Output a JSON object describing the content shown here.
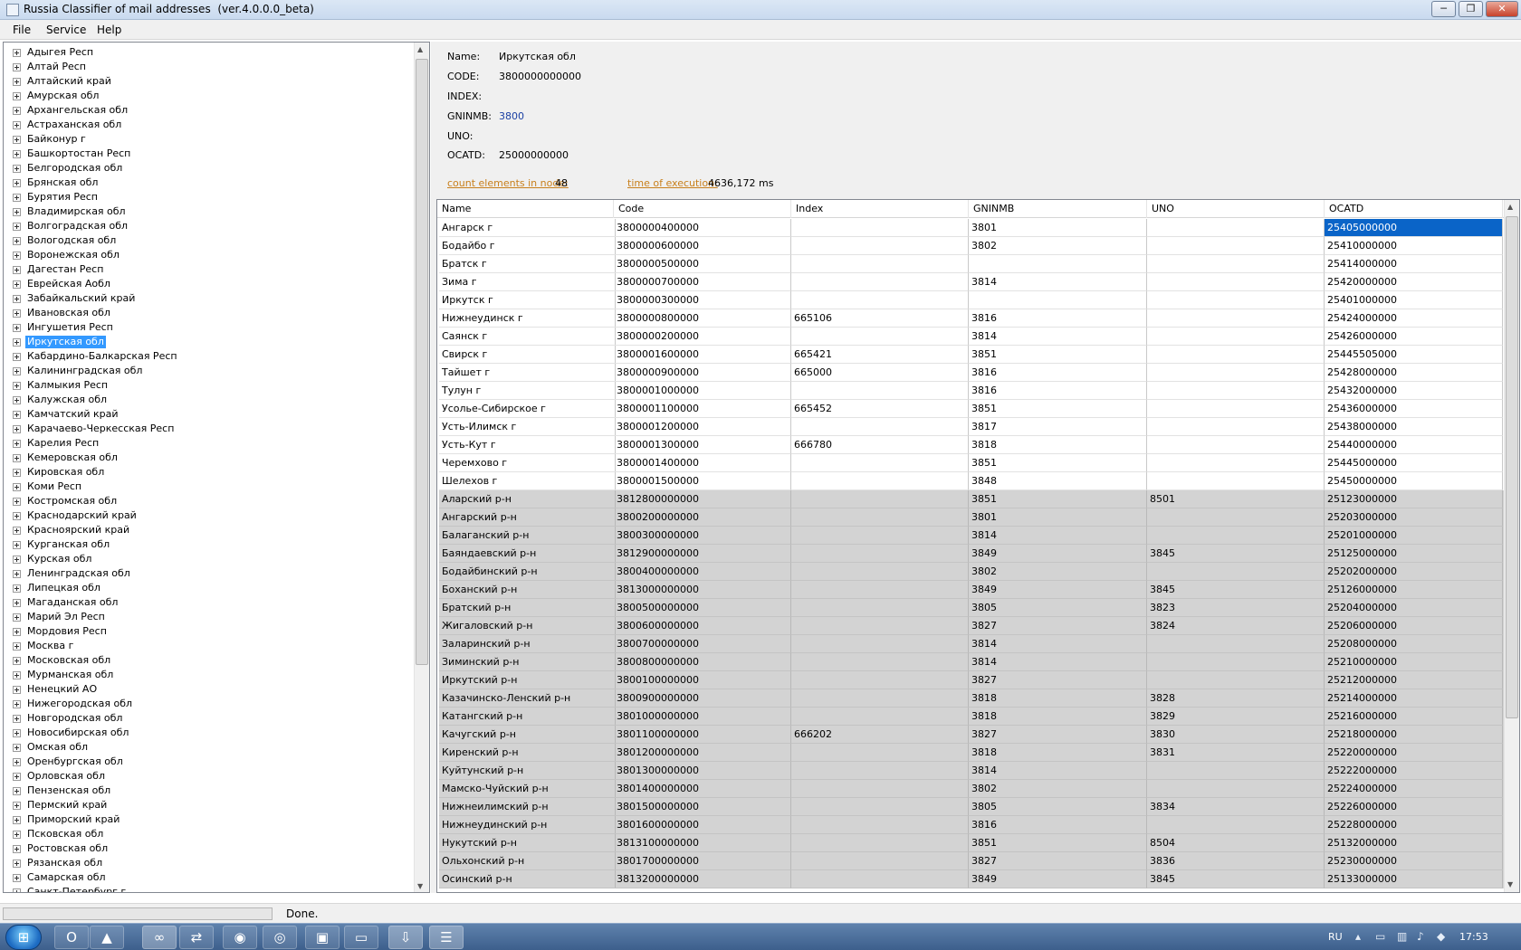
{
  "window": {
    "title": "Russia Classifier of mail addresses  (ver.4.0.0.0_beta)",
    "minimize_glyph": "─",
    "maximize_glyph": "❐",
    "close_glyph": "✕"
  },
  "menu": {
    "items": [
      "File",
      "Service",
      "Help"
    ]
  },
  "tree": {
    "selected_index": 20,
    "items": [
      "Адыгея Респ",
      "Алтай Респ",
      "Алтайский край",
      "Амурская обл",
      "Архангельская обл",
      "Астраханская обл",
      "Байконур г",
      "Башкортостан Респ",
      "Белгородская обл",
      "Брянская обл",
      "Бурятия Респ",
      "Владимирская обл",
      "Волгоградская обл",
      "Вологодская обл",
      "Воронежская обл",
      "Дагестан Респ",
      "Еврейская Аобл",
      "Забайкальский край",
      "Ивановская обл",
      "Ингушетия Респ",
      "Иркутская обл",
      "Кабардино-Балкарская Респ",
      "Калининградская обл",
      "Калмыкия Респ",
      "Калужская обл",
      "Камчатский край",
      "Карачаево-Черкесская Респ",
      "Карелия Респ",
      "Кемеровская обл",
      "Кировская обл",
      "Коми Респ",
      "Костромская обл",
      "Краснодарский край",
      "Красноярский край",
      "Курганская обл",
      "Курская обл",
      "Ленинградская обл",
      "Липецкая обл",
      "Магаданская обл",
      "Марий Эл Респ",
      "Мордовия Респ",
      "Москва г",
      "Московская обл",
      "Мурманская обл",
      "Ненецкий АО",
      "Нижегородская обл",
      "Новгородская обл",
      "Новосибирская обл",
      "Омская обл",
      "Оренбургская обл",
      "Орловская обл",
      "Пензенская обл",
      "Пермский край",
      "Приморский край",
      "Псковская обл",
      "Ростовская обл",
      "Рязанская обл",
      "Самарская обл",
      "Санкт-Петербург г"
    ]
  },
  "details": {
    "name_label": "Name:",
    "name_value": "Иркутская обл",
    "code_label": "CODE:",
    "code_value": "3800000000000",
    "index_label": "INDEX:",
    "index_value": "",
    "gninmb_label": "GNINMB:",
    "gninmb_value": "3800",
    "uno_label": "UNO:",
    "uno_value": "",
    "ocatd_label": "OCATD:",
    "ocatd_value": "25000000000",
    "count_label": "count elements in node:",
    "count_value": "48",
    "time_label": "time of execution:",
    "time_value": "4636,172 ms"
  },
  "grid": {
    "columns": [
      "Name",
      "Code",
      "Index",
      "GNINMB",
      "UNO",
      "OCATD"
    ],
    "selected": {
      "row": 0,
      "col": 5
    },
    "first_alt_row": 15,
    "rows": [
      [
        "Ангарск г",
        "3800000400000",
        "",
        "3801",
        "",
        "25405000000"
      ],
      [
        "Бодайбо г",
        "3800000600000",
        "",
        "3802",
        "",
        "25410000000"
      ],
      [
        "Братск г",
        "3800000500000",
        "",
        "",
        "",
        "25414000000"
      ],
      [
        "Зима г",
        "3800000700000",
        "",
        "3814",
        "",
        "25420000000"
      ],
      [
        "Иркутск г",
        "3800000300000",
        "",
        "",
        "",
        "25401000000"
      ],
      [
        "Нижнеудинск г",
        "3800000800000",
        "665106",
        "3816",
        "",
        "25424000000"
      ],
      [
        "Саянск г",
        "3800000200000",
        "",
        "3814",
        "",
        "25426000000"
      ],
      [
        "Свирск г",
        "3800001600000",
        "665421",
        "3851",
        "",
        "25445505000"
      ],
      [
        "Тайшет г",
        "3800000900000",
        "665000",
        "3816",
        "",
        "25428000000"
      ],
      [
        "Тулун г",
        "3800001000000",
        "",
        "3816",
        "",
        "25432000000"
      ],
      [
        "Усолье-Сибирское г",
        "3800001100000",
        "665452",
        "3851",
        "",
        "25436000000"
      ],
      [
        "Усть-Илимск г",
        "3800001200000",
        "",
        "3817",
        "",
        "25438000000"
      ],
      [
        "Усть-Кут г",
        "3800001300000",
        "666780",
        "3818",
        "",
        "25440000000"
      ],
      [
        "Черемхово г",
        "3800001400000",
        "",
        "3851",
        "",
        "25445000000"
      ],
      [
        "Шелехов г",
        "3800001500000",
        "",
        "3848",
        "",
        "25450000000"
      ],
      [
        "Аларский р-н",
        "3812800000000",
        "",
        "3851",
        "8501",
        "25123000000"
      ],
      [
        "Ангарский р-н",
        "3800200000000",
        "",
        "3801",
        "",
        "25203000000"
      ],
      [
        "Балаганский р-н",
        "3800300000000",
        "",
        "3814",
        "",
        "25201000000"
      ],
      [
        "Баяндаевский р-н",
        "3812900000000",
        "",
        "3849",
        "3845",
        "25125000000"
      ],
      [
        "Бодайбинский р-н",
        "3800400000000",
        "",
        "3802",
        "",
        "25202000000"
      ],
      [
        "Боханский р-н",
        "3813000000000",
        "",
        "3849",
        "3845",
        "25126000000"
      ],
      [
        "Братский р-н",
        "3800500000000",
        "",
        "3805",
        "3823",
        "25204000000"
      ],
      [
        "Жигаловский р-н",
        "3800600000000",
        "",
        "3827",
        "3824",
        "25206000000"
      ],
      [
        "Заларинский р-н",
        "3800700000000",
        "",
        "3814",
        "",
        "25208000000"
      ],
      [
        "Зиминский р-н",
        "3800800000000",
        "",
        "3814",
        "",
        "25210000000"
      ],
      [
        "Иркутский р-н",
        "3800100000000",
        "",
        "3827",
        "",
        "25212000000"
      ],
      [
        "Казачинско-Ленский р-н",
        "3800900000000",
        "",
        "3818",
        "3828",
        "25214000000"
      ],
      [
        "Катангский р-н",
        "3801000000000",
        "",
        "3818",
        "3829",
        "25216000000"
      ],
      [
        "Качугский р-н",
        "3801100000000",
        "666202",
        "3827",
        "3830",
        "25218000000"
      ],
      [
        "Киренский р-н",
        "3801200000000",
        "",
        "3818",
        "3831",
        "25220000000"
      ],
      [
        "Куйтунский р-н",
        "3801300000000",
        "",
        "3814",
        "",
        "25222000000"
      ],
      [
        "Мамско-Чуйский р-н",
        "3801400000000",
        "",
        "3802",
        "",
        "25224000000"
      ],
      [
        "Нижнеилимский р-н",
        "3801500000000",
        "",
        "3805",
        "3834",
        "25226000000"
      ],
      [
        "Нижнеудинский р-н",
        "3801600000000",
        "",
        "3816",
        "",
        "25228000000"
      ],
      [
        "Нукутский р-н",
        "3813100000000",
        "",
        "3851",
        "8504",
        "25132000000"
      ],
      [
        "Ольхонский р-н",
        "3801700000000",
        "",
        "3827",
        "3836",
        "25230000000"
      ],
      [
        "Осинский р-н",
        "3813200000000",
        "",
        "3849",
        "3845",
        "25133000000"
      ]
    ]
  },
  "status": {
    "text": "Done.",
    "progress": 0
  },
  "taskbar": {
    "start_glyph": "⊞",
    "apps": [
      {
        "name": "opera-icon",
        "glyph": "O",
        "active": false
      },
      {
        "name": "aimp-icon",
        "glyph": "▲",
        "active": false
      },
      {
        "name": "infinity-icon",
        "glyph": "∞",
        "active": true
      },
      {
        "name": "network-tool-icon",
        "glyph": "⇄",
        "active": false
      },
      {
        "name": "firefox-icon",
        "glyph": "◉",
        "active": false
      },
      {
        "name": "chrome-icon",
        "glyph": "◎",
        "active": false
      },
      {
        "name": "save-disk-icon",
        "glyph": "▣",
        "active": false
      },
      {
        "name": "folder-icon",
        "glyph": "▭",
        "active": false
      },
      {
        "name": "installer-icon",
        "glyph": "⇩",
        "active": true
      },
      {
        "name": "classifier-app-icon",
        "glyph": "☰",
        "active": true
      }
    ],
    "language": "RU",
    "clock": "17:53"
  }
}
